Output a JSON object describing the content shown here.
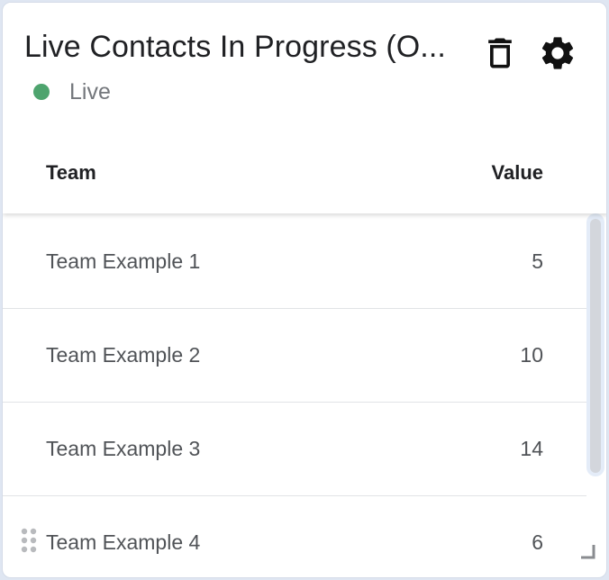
{
  "widget": {
    "title": "Live Contacts In Progress (O...",
    "status": {
      "label": "Live",
      "color": "#4ea46e"
    },
    "actions": {
      "delete_icon": "trash-icon",
      "settings_icon": "gear-icon"
    }
  },
  "table": {
    "columns": [
      "Team",
      "Value"
    ],
    "rows": [
      {
        "team": "Team Example 1",
        "value": "5"
      },
      {
        "team": "Team Example 2",
        "value": "10"
      },
      {
        "team": "Team Example 3",
        "value": "14"
      },
      {
        "team": "Team Example 4",
        "value": "6"
      }
    ]
  }
}
